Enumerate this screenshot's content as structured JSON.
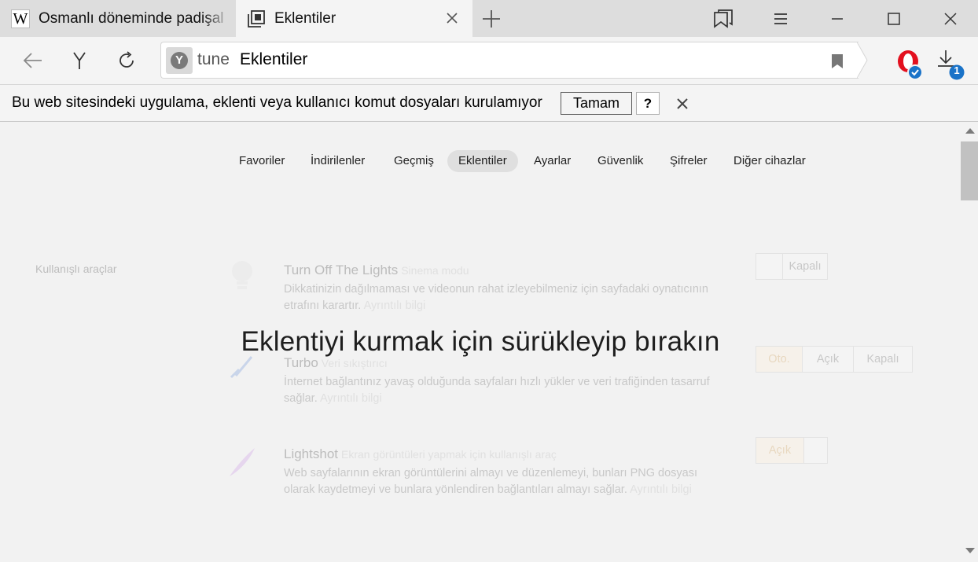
{
  "tabs": [
    {
      "title": "Osmanlı döneminde padişal",
      "favicon": "wikipedia-w-icon",
      "favicon_text": "W"
    },
    {
      "title": "Eklentiler",
      "favicon": "extensions-icon"
    }
  ],
  "address_bar": {
    "scheme": "tune",
    "host": "Eklentiler",
    "site_badge": "Y"
  },
  "downloads_count": "1",
  "infobar": {
    "message": "Bu web sitesindeki uygulama, eklenti veya kullanıcı komut dosyaları kurulamıyor",
    "ok_label": "Tamam",
    "help_label": "?"
  },
  "settings_nav": {
    "favorites": "Favoriler",
    "downloads": "İndirilenler",
    "history": "Geçmiş",
    "extensions": "Eklentiler",
    "settings": "Ayarlar",
    "security": "Güvenlik",
    "passwords": "Şifreler",
    "other_devices": "Diğer cihazlar"
  },
  "section_title": "Kullanışlı araçlar",
  "extensions": [
    {
      "name": "Turn Off The Lights",
      "subtitle": "Sinema modu",
      "description": "Dikkatinizin dağılmaması ve videonun rahat izleyebilmeniz için sayfadaki oynatıcının etrafını karartır.",
      "more": "Ayrıntılı bilgi",
      "toggle_state": "Kapalı"
    },
    {
      "name": "Turbo",
      "subtitle": "Veri sıkıştırıcı",
      "description": "İnternet bağlantınız yavaş olduğunda sayfaları hızlı yükler ve veri trafiğinden tasarruf sağlar.",
      "more": "Ayrıntılı bilgi",
      "options": {
        "auto": "Oto.",
        "on": "Açık",
        "off": "Kapalı"
      }
    },
    {
      "name": "Lightshot",
      "subtitle": "Ekran görüntüleri yapmak için kullanışlı araç",
      "description": "Web sayfalarının ekran görüntülerini almayı ve düzenlemeyi, bunları PNG dosyası olarak kaydetmeyi ve bunlara yönlendiren bağlantıları almayı sağlar.",
      "more": "Ayrıntılı bilgi",
      "toggle_state": "Açık"
    }
  ],
  "drop_overlay": "Eklentiyi kurmak için sürükleyip bırakın"
}
